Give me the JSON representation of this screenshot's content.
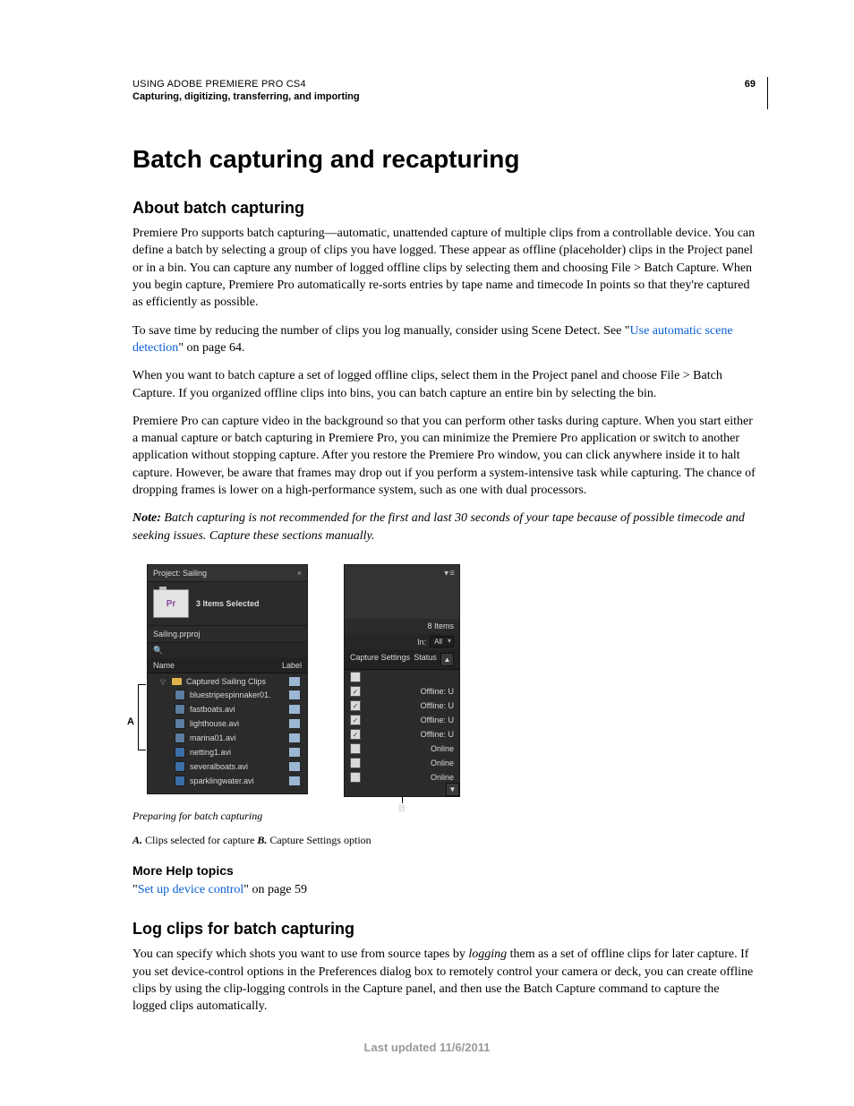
{
  "header": {
    "doc_title": "USING ADOBE PREMIERE PRO CS4",
    "chapter": "Capturing, digitizing, transferring, and importing",
    "page_number": "69"
  },
  "h1": "Batch capturing and recapturing",
  "sections": {
    "about": {
      "title": "About batch capturing",
      "p1": "Premiere Pro supports batch capturing—automatic, unattended capture of multiple clips from a controllable device. You can define a batch by selecting a group of clips you have logged. These appear as offline (placeholder) clips in the Project panel or in a bin. You can capture any number of logged offline clips by selecting them and choosing File > Batch Capture. When you begin capture, Premiere Pro automatically re-sorts entries by tape name and timecode In points so that they're captured as efficiently as possible.",
      "p2_a": "To save time by reducing the number of clips you log manually, consider using Scene Detect. See \"",
      "p2_link": "Use automatic scene detection",
      "p2_b": "\" on page 64.",
      "p3": "When you want to batch capture a set of logged offline clips, select them in the Project panel and choose File > Batch Capture. If you organized offline clips into bins, you can batch capture an entire bin by selecting the bin.",
      "p4": "Premiere Pro can capture video in the background so that you can perform other tasks during capture. When you start either a manual capture or batch capturing in Premiere Pro, you can minimize the Premiere Pro application or switch to another application without stopping capture. After you restore the Premiere Pro window, you can click anywhere inside it to halt capture. However, be aware that frames may drop out if you perform a system-intensive task while capturing. The chance of dropping frames is lower on a high-performance system, such as one with dual processors.",
      "note_label": "Note:",
      "note_text": " Batch capturing is not recommended for the first and last 30 seconds of your tape because of possible timecode and seeking issues. Capture these sections manually."
    },
    "log": {
      "title": "Log clips for batch capturing",
      "p1_a": "You can specify which shots you want to use from source tapes by ",
      "p1_em": "logging",
      "p1_b": " them as a set of offline clips for later capture. If you set device-control options in the Preferences dialog box to remotely control your camera or deck, you can create offline clips by using the clip-logging controls in the Capture panel, and then use the Batch Capture command to capture the logged clips automatically."
    }
  },
  "figure": {
    "caption": "Preparing for batch capturing",
    "keyA": "A.",
    "keyA_text": " Clips selected for capture  ",
    "keyB": "B.",
    "keyB_text": " Capture Settings option",
    "calloutA": "A",
    "calloutB": "B",
    "panelA": {
      "tab": "Project: Sailing",
      "thumb_label": "Pr",
      "selected_info": "3 Items Selected",
      "project_name": "Sailing.prproj",
      "col_name": "Name",
      "col_label": "Label",
      "bin": "Captured Sailing Clips",
      "rows": [
        "bluestripespinnaker01.",
        "fastboats.avi",
        "lighthouse.avi",
        "marina01.avi",
        "netting1.avi",
        "severalboats.avi",
        "sparklingwater.avi"
      ]
    },
    "panelB": {
      "items": "8 Items",
      "in_label": "In:",
      "in_value": "All",
      "col_capture": "Capture Settings",
      "col_status": "Status",
      "rows": [
        {
          "checked": false,
          "status": ""
        },
        {
          "checked": true,
          "status": "Offline: U"
        },
        {
          "checked": true,
          "status": "Offline: U"
        },
        {
          "checked": true,
          "status": "Offline: U"
        },
        {
          "checked": true,
          "status": "Offline: U"
        },
        {
          "checked": false,
          "status": "Online"
        },
        {
          "checked": false,
          "status": "Online"
        },
        {
          "checked": false,
          "status": "Online"
        }
      ]
    }
  },
  "more_help": {
    "title": "More Help topics",
    "link": "Set up device control",
    "suffix": "\" on page 59",
    "prefix": "\""
  },
  "footer": "Last updated 11/6/2011"
}
